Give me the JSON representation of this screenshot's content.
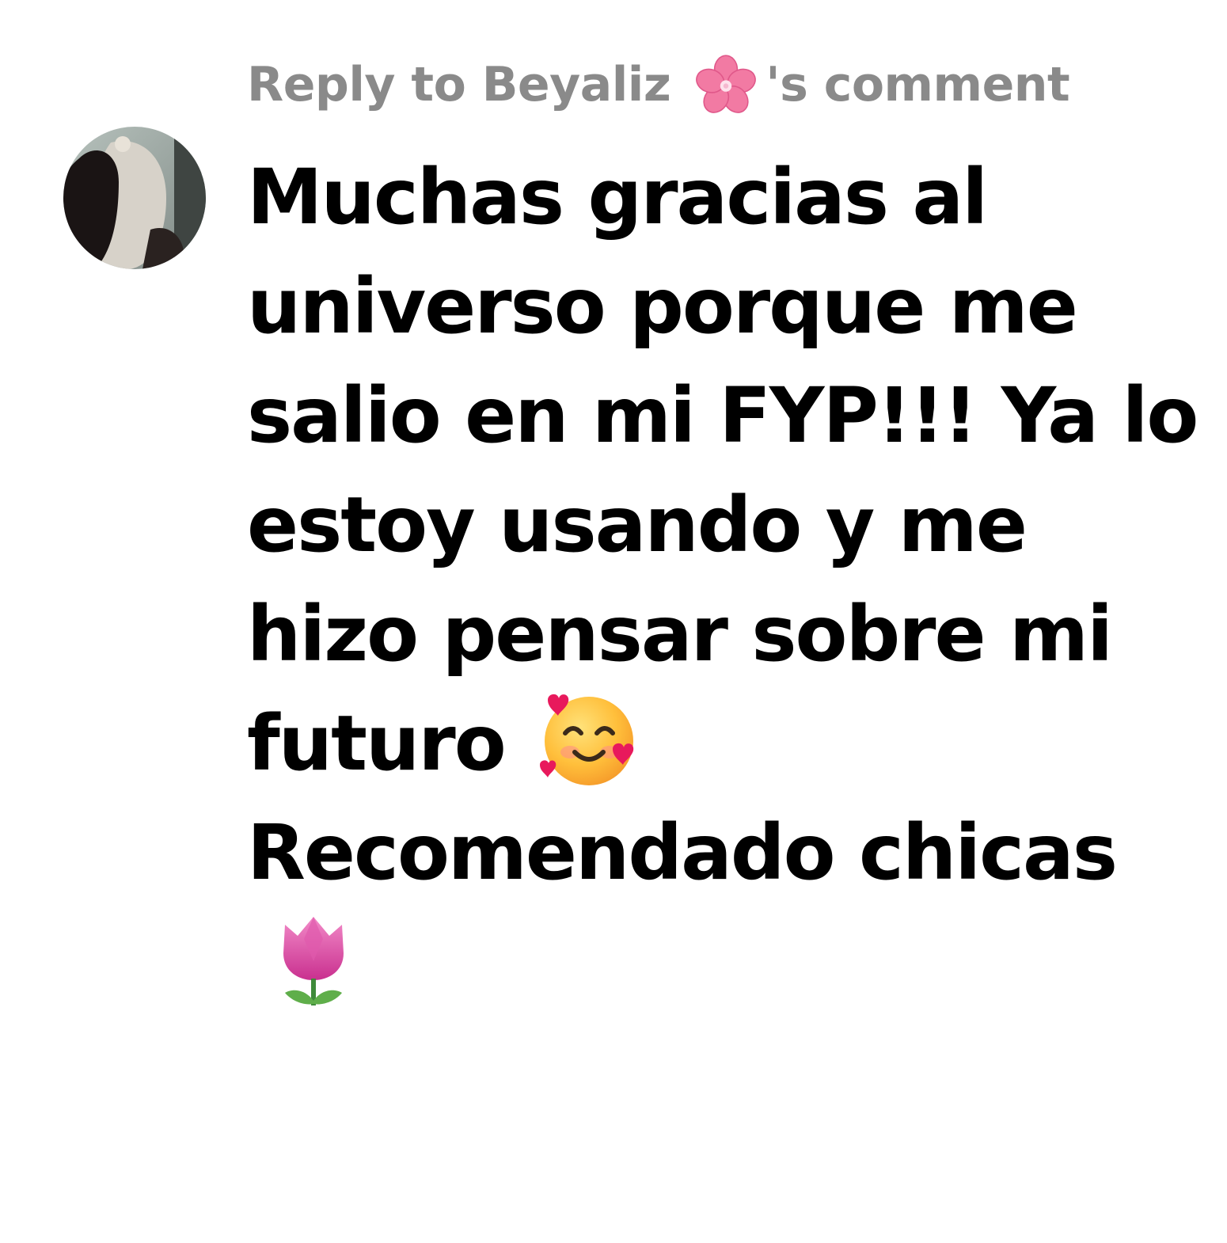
{
  "reply_header": {
    "prefix": "Reply to Beyaliz",
    "emoji": "cherry-blossom-icon",
    "suffix": "'s comment"
  },
  "avatar": {
    "description": "user-avatar"
  },
  "comment": {
    "lines": [
      "Muchas gracias al",
      "universo porque me",
      "salio en mi FYP!!! Ya lo",
      "estoy usando y me",
      "hizo pensar sobre mi",
      "futuro",
      "Recomendado chicas"
    ],
    "emojis": [
      "smiling-face-with-hearts-icon",
      "tulip-icon"
    ]
  },
  "colors": {
    "header_text": "#8a8a8a",
    "comment_text": "#000000",
    "background": "#ffffff"
  }
}
